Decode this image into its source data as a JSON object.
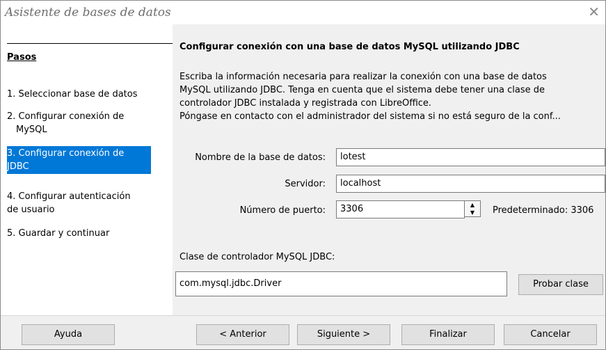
{
  "window": {
    "title": "Asistente de bases de datos",
    "close_glyph": "✕"
  },
  "steps": {
    "header": "Pasos",
    "items": [
      {
        "label": "1. Seleccionar base de datos"
      },
      {
        "label": "2. Configurar conexión de",
        "label2": "MySQL"
      },
      {
        "label": "3. Configurar conexión de",
        "label2": "JDBC"
      },
      {
        "label": "4. Configurar autenticación",
        "label2": "de usuario"
      },
      {
        "label": "5. Guardar y continuar"
      }
    ]
  },
  "main": {
    "heading": "Configurar conexión con una base de datos MySQL utilizando JDBC",
    "description": [
      "Escriba la información necesaria para realizar la conexión con una base de datos",
      "MySQL utilizando JDBC. Tenga en cuenta que el sistema debe tener una clase de",
      "controlador JDBC instalada y registrada con LibreOffice.",
      "Póngase en contacto con el administrador del sistema si no está seguro de la conf..."
    ],
    "db_name_label": "Nombre de la base de datos:",
    "db_name_value": "lotest",
    "server_label": "Servidor:",
    "server_value": "localhost",
    "port_label": "Número de puerto:",
    "port_value": "3306",
    "port_default": "Predeterminado: 3306",
    "driver_label": "Clase de controlador MySQL JDBC:",
    "driver_value": "com.mysql.jdbc.Driver",
    "test_class_button": "Probar clase"
  },
  "footer": {
    "help": "Ayuda",
    "back": "< Anterior",
    "next": "Siguiente >",
    "finish": "Finalizar",
    "cancel": "Cancelar"
  }
}
